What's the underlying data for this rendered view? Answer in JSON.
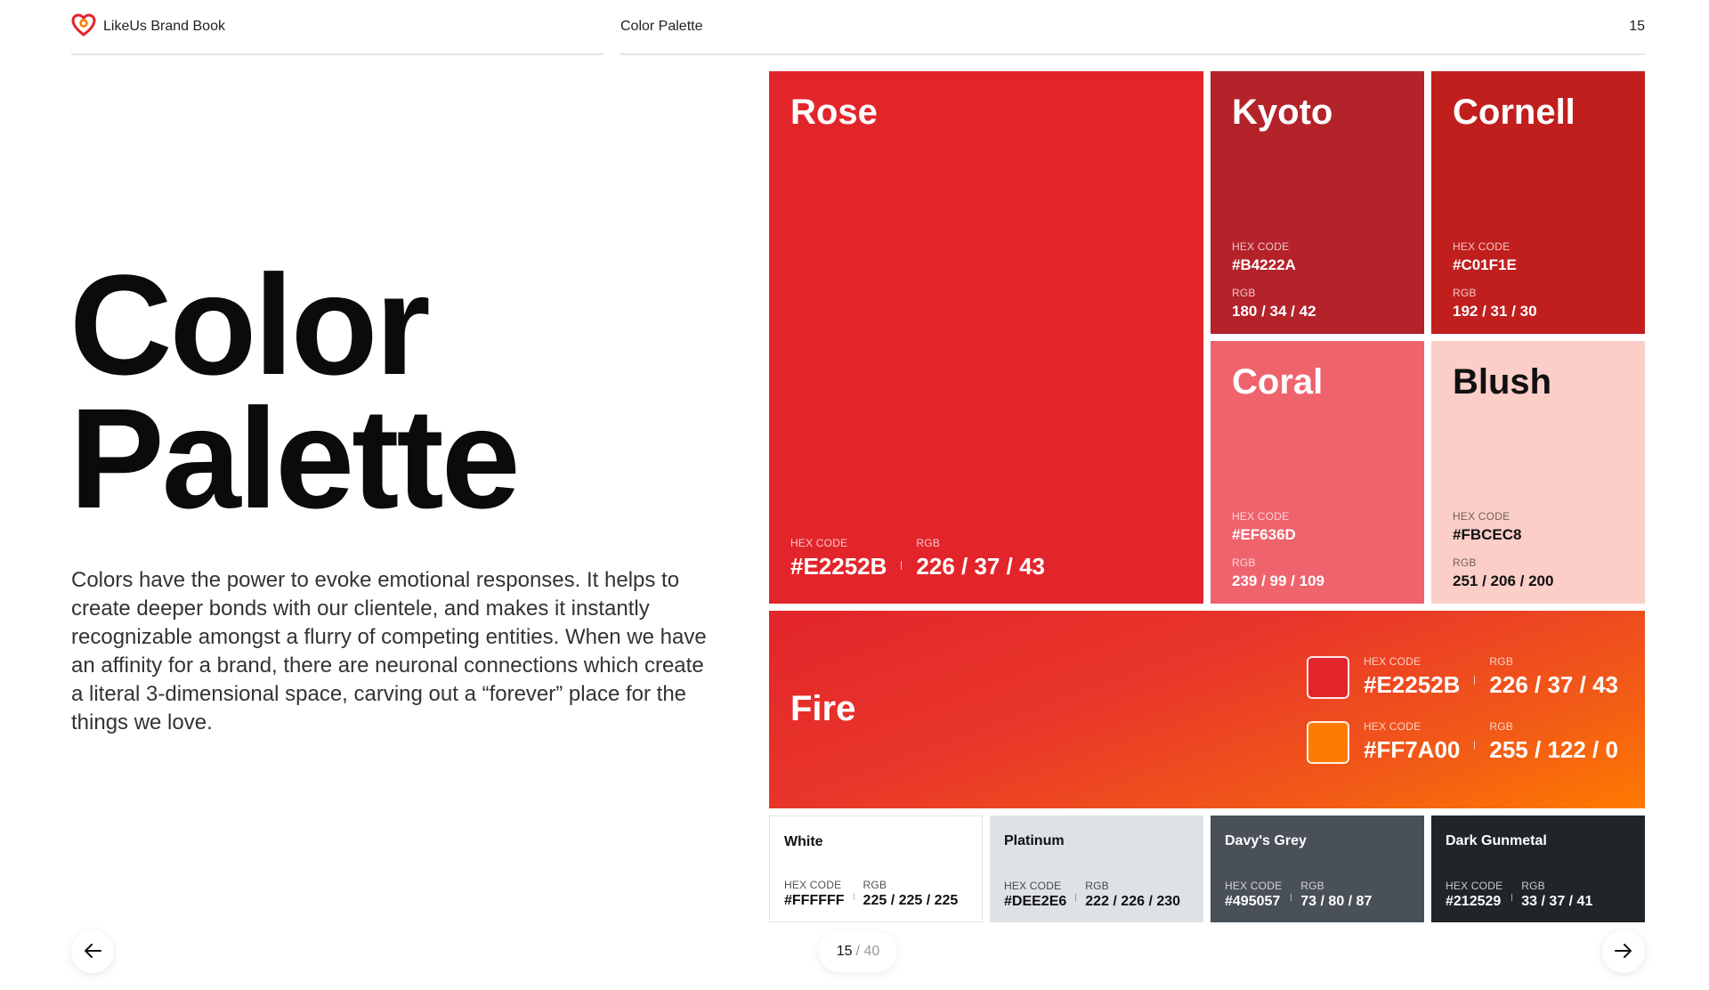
{
  "header": {
    "brand": "LikeUs Brand Book",
    "section": "Color Palette",
    "page_number": "15"
  },
  "hero": {
    "title_line1": "Color",
    "title_line2": "Palette",
    "description": "Colors have the power to evoke emotional responses. It helps to create deeper bonds with our clientele, and makes it instantly recognizable amongst a flurry of competing entities. When we have an affinity for a brand, there are neuronal connections which create a literal 3-dimensional space, carving out a “forever” place for the things we love."
  },
  "labels": {
    "hex": "HEX CODE",
    "rgb": "RGB"
  },
  "colors": {
    "rose": {
      "name": "Rose",
      "hex": "#E2252B",
      "rgb": "226 / 37 / 43"
    },
    "kyoto": {
      "name": "Kyoto",
      "hex": "#B4222A",
      "rgb": "180 / 34 / 42"
    },
    "cornell": {
      "name": "Cornell",
      "hex": "#C01F1E",
      "rgb": "192 / 31 / 30"
    },
    "coral": {
      "name": "Coral",
      "hex": "#EF636D",
      "rgb": "239 / 99 / 109"
    },
    "blush": {
      "name": "Blush",
      "hex": "#FBCEC8",
      "rgb": "251 / 206 / 200"
    },
    "fire": {
      "name": "Fire",
      "stops": [
        {
          "hex": "#E2252B",
          "rgb": "226 / 37 / 43"
        },
        {
          "hex": "#FF7A00",
          "rgb": "255 / 122 / 0"
        }
      ]
    },
    "white": {
      "name": "White",
      "hex": "#FFFFFF",
      "rgb": "225 / 225 / 225"
    },
    "platinum": {
      "name": "Platinum",
      "hex": "#DEE2E6",
      "rgb": "222 / 226 / 230"
    },
    "davys_grey": {
      "name": "Davy's Grey",
      "hex": "#495057",
      "rgb": "73 / 80 / 87"
    },
    "dark_gunmetal": {
      "name": "Dark Gunmetal",
      "hex": "#212529",
      "rgb": "33 / 37 / 41"
    }
  },
  "pager": {
    "current": "15",
    "total": "/ 40"
  },
  "icons": {
    "logo": "heart-logo-icon",
    "prev": "arrow-left-icon",
    "next": "arrow-right-icon"
  },
  "accent": "#E2252B"
}
